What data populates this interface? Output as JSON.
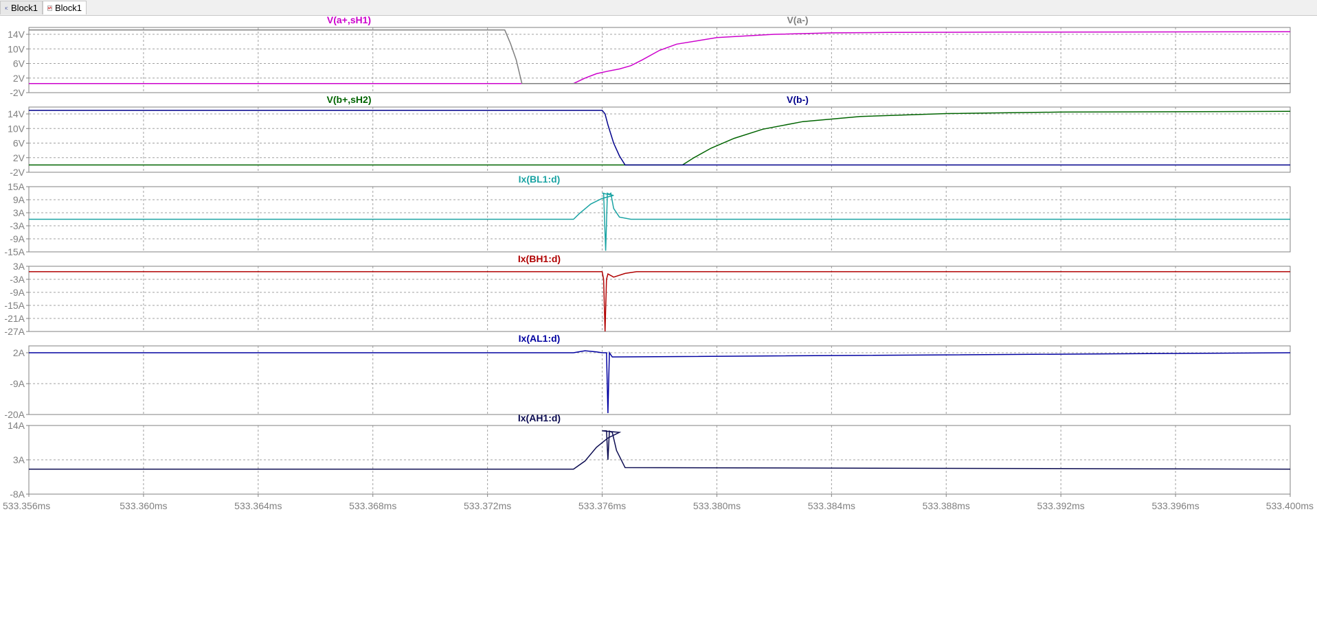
{
  "tabs": [
    {
      "label": "Block1",
      "icon": "schematic-icon"
    },
    {
      "label": "Block1",
      "icon": "waveform-icon"
    }
  ],
  "colors": {
    "magenta": "#cc00cc",
    "gray": "#7f7f7f",
    "green": "#006400",
    "navy": "#00008b",
    "teal": "#1aa3a3",
    "red": "#b00000",
    "darkblue": "#0000a0",
    "midnight": "#0a0a50",
    "tick": "#808080",
    "grid": "#a0a0a0"
  },
  "chart_data": {
    "type": "line",
    "xlabel_ticks": [
      "533.356ms",
      "533.360ms",
      "533.364ms",
      "533.368ms",
      "533.372ms",
      "533.376ms",
      "533.380ms",
      "533.384ms",
      "533.388ms",
      "533.392ms",
      "533.396ms",
      "533.400ms"
    ],
    "xlim": [
      533.356,
      533.4
    ],
    "panes": [
      {
        "ylim": [
          -2,
          16
        ],
        "ytick_labels": [
          "14V",
          "10V",
          "6V",
          "2V",
          "-2V"
        ],
        "ytick_values": [
          14,
          10,
          6,
          2,
          -2
        ],
        "series": [
          {
            "name": "V(a+,sH1)",
            "color": "#cc00cc",
            "x": [
              533.356,
              533.375,
              533.3754,
              533.3758,
              533.3762,
              533.3766,
              533.377,
              533.3774,
              533.378,
              533.3786,
              533.38,
              533.382,
              533.384,
              533.386,
              533.39,
              533.4
            ],
            "y": [
              0.5,
              0.5,
              2.0,
              3.2,
              3.9,
              4.5,
              5.4,
              7.0,
              9.6,
              11.3,
              13.1,
              14.0,
              14.4,
              14.5,
              14.6,
              14.7
            ]
          },
          {
            "name": "V(a-)",
            "color": "#7f7f7f",
            "x": [
              533.356,
              533.3726,
              533.3728,
              533.373,
              533.3732,
              533.4
            ],
            "y": [
              15.2,
              15.2,
              11.5,
              7.0,
              0.5,
              0.5
            ]
          }
        ]
      },
      {
        "ylim": [
          -2,
          16
        ],
        "ytick_labels": [
          "14V",
          "10V",
          "6V",
          "2V",
          "-2V"
        ],
        "ytick_values": [
          14,
          10,
          6,
          2,
          -2
        ],
        "series": [
          {
            "name": "V(b+,sH2)",
            "color": "#006400",
            "x": [
              533.356,
              533.3788,
              533.3792,
              533.3798,
              533.3806,
              533.3816,
              533.383,
              533.385,
              533.388,
              533.392,
              533.4
            ],
            "y": [
              0.0,
              0.0,
              2.0,
              4.6,
              7.3,
              9.8,
              11.9,
              13.3,
              14.1,
              14.5,
              14.7
            ]
          },
          {
            "name": "V(b-)",
            "color": "#00008b",
            "x": [
              533.356,
              533.376,
              533.3761,
              533.3762,
              533.3764,
              533.3766,
              533.3768,
              533.4
            ],
            "y": [
              15.0,
              15.0,
              14.0,
              11.0,
              6.0,
              2.5,
              0.0,
              0.0
            ]
          }
        ]
      },
      {
        "ylim": [
          -15,
          15
        ],
        "ytick_labels": [
          "15A",
          "9A",
          "3A",
          "-3A",
          "-9A",
          "-15A"
        ],
        "ytick_values": [
          15,
          9,
          3,
          -3,
          -9,
          -15
        ],
        "series": [
          {
            "name": "Ix(BL1:d)",
            "color": "#1aa3a3",
            "x": [
              533.356,
              533.375,
              533.3752,
              533.3756,
              533.376,
              533.3764,
              533.376,
              533.37605,
              533.37612,
              533.37618,
              533.37625,
              533.3763,
              533.3764,
              533.3766,
              533.377,
              533.4
            ],
            "y": [
              0.0,
              0.0,
              2.6,
              7.0,
              9.6,
              11.0,
              12.0,
              12.0,
              -14.5,
              12.0,
              11.5,
              12.0,
              5.0,
              1.0,
              0.0,
              0.0
            ]
          }
        ]
      },
      {
        "ylim": [
          -27,
          3
        ],
        "ytick_labels": [
          "3A",
          "-3A",
          "-9A",
          "-15A",
          "-21A",
          "-27A"
        ],
        "ytick_values": [
          3,
          -3,
          -9,
          -15,
          -21,
          -27
        ],
        "series": [
          {
            "name": "Ix(BH1:d)",
            "color": "#b00000",
            "x": [
              533.356,
              533.376,
              533.37605,
              533.3761,
              533.37615,
              533.3762,
              533.3764,
              533.3768,
              533.3772,
              533.4
            ],
            "y": [
              0.5,
              0.5,
              -3.0,
              -27.0,
              -3.0,
              -0.5,
              -2.0,
              -0.3,
              0.5,
              0.5
            ]
          }
        ]
      },
      {
        "ylim": [
          -20,
          2
        ],
        "ytick_labels": [
          "2A",
          "-9A",
          "-20A"
        ],
        "ytick_values": [
          2,
          -9,
          -20
        ],
        "series": [
          {
            "name": "Ix(AL1:d)",
            "color": "#0000a0",
            "x": [
              533.356,
              533.375,
              533.3754,
              533.3758,
              533.376,
              533.37615,
              533.3762,
              533.37625,
              533.37635,
              533.4
            ],
            "y": [
              2.0,
              2.0,
              2.7,
              2.3,
              2.0,
              2.0,
              -19.5,
              2.0,
              0.5,
              2.0
            ]
          }
        ]
      },
      {
        "ylim": [
          -8,
          14
        ],
        "ytick_labels": [
          "14A",
          "3A",
          "-8A"
        ],
        "ytick_values": [
          14,
          3,
          -8
        ],
        "series": [
          {
            "name": "Ix(AH1:d)",
            "color": "#0a0a50",
            "x": [
              533.356,
              533.375,
              533.3754,
              533.3758,
              533.3762,
              533.3766,
              533.376,
              533.37615,
              533.3762,
              533.37625,
              533.37635,
              533.3765,
              533.3768,
              533.4
            ],
            "y": [
              0.0,
              0.0,
              2.6,
              7.0,
              10.0,
              11.8,
              12.3,
              12.3,
              3.0,
              12.2,
              11.8,
              6.0,
              0.5,
              0.0
            ]
          }
        ]
      }
    ]
  }
}
